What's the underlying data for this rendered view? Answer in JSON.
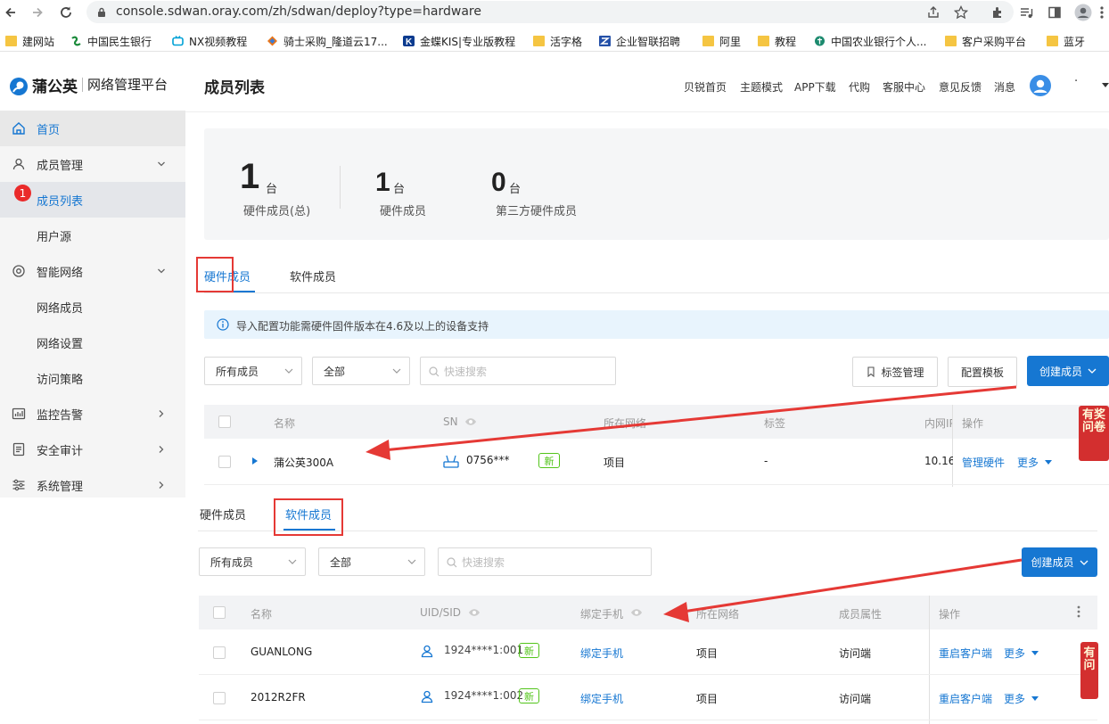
{
  "browser": {
    "url": "console.sdwan.oray.com/zh/sdwan/deploy?type=hardware",
    "bookmarks": [
      "建网站",
      "中国民生银行",
      "NX视频教程",
      "骑士采购_隆道云17...",
      "金蝶KIS|专业版教程",
      "活字格",
      "企业智联招聘",
      "阿里",
      "教程",
      "中国农业银行个人...",
      "客户采购平台",
      "蓝牙"
    ]
  },
  "app": {
    "brand": "蒲公英",
    "platform": "网络管理平台",
    "page_title": "成员列表",
    "nav": [
      "贝锐首页",
      "主题模式",
      "APP下载",
      "代购",
      "客服中心",
      "意见反馈",
      "消息"
    ],
    "user_dots": "·",
    "brand_color": "#1677d2"
  },
  "sidebar": {
    "items": [
      {
        "label": "首页",
        "icon": "home-icon"
      },
      {
        "label": "成员管理",
        "icon": "user-icon"
      },
      {
        "label": "成员列表",
        "badge": "1"
      },
      {
        "label": "用户源"
      },
      {
        "label": "智能网络",
        "icon": "network-icon"
      },
      {
        "label": "网络成员"
      },
      {
        "label": "网络设置"
      },
      {
        "label": "访问策略"
      },
      {
        "label": "监控告警",
        "icon": "monitor-icon"
      },
      {
        "label": "安全审计",
        "icon": "audit-icon"
      },
      {
        "label": "系统管理",
        "icon": "settings-icon"
      }
    ]
  },
  "stats": [
    {
      "value": "1",
      "unit": "台",
      "label": "硬件成员(总)"
    },
    {
      "value": "1",
      "unit": "台",
      "label": "硬件成员"
    },
    {
      "value": "0",
      "unit": "台",
      "label": "第三方硬件成员"
    }
  ],
  "hardware": {
    "tabs": [
      "硬件成员",
      "软件成员"
    ],
    "notice": "导入配置功能需硬件固件版本在4.6及以上的设备支持",
    "filter1": "所有成员",
    "filter2": "全部",
    "search_placeholder": "快速搜索",
    "tag_btn": "标签管理",
    "template_btn": "配置模板",
    "create_btn": "创建成员",
    "columns": [
      "名称",
      "SN",
      "所在网络",
      "标签",
      "内网IP",
      "操作"
    ],
    "rows": [
      {
        "name": "蒲公英300A",
        "sn": "0756***",
        "badge": "新",
        "network": "项目",
        "tag": "-",
        "ip": "10.16",
        "action": "管理硬件",
        "more": "更多"
      }
    ]
  },
  "software": {
    "tabs": [
      "硬件成员",
      "软件成员"
    ],
    "filter1": "所有成员",
    "filter2": "全部",
    "search_placeholder": "快速搜索",
    "create_btn": "创建成员",
    "columns": [
      "名称",
      "UID/SID",
      "绑定手机",
      "所在网络",
      "成员属性",
      "操作"
    ],
    "rows": [
      {
        "name": "GUANLONG",
        "uid": "1924****1:001",
        "badge": "新",
        "phone": "绑定手机",
        "network": "项目",
        "attr": "访问端",
        "action": "重启客户端",
        "more": "更多"
      },
      {
        "name": "2012R2FR",
        "uid": "1924****1:002",
        "badge": "新",
        "phone": "绑定手机",
        "network": "项目",
        "attr": "访问端",
        "action": "重启客户端",
        "more": "更多"
      }
    ]
  },
  "promo": {
    "text1": "有奖",
    "text2": "问卷",
    "text3": "有",
    "text4": "问"
  }
}
